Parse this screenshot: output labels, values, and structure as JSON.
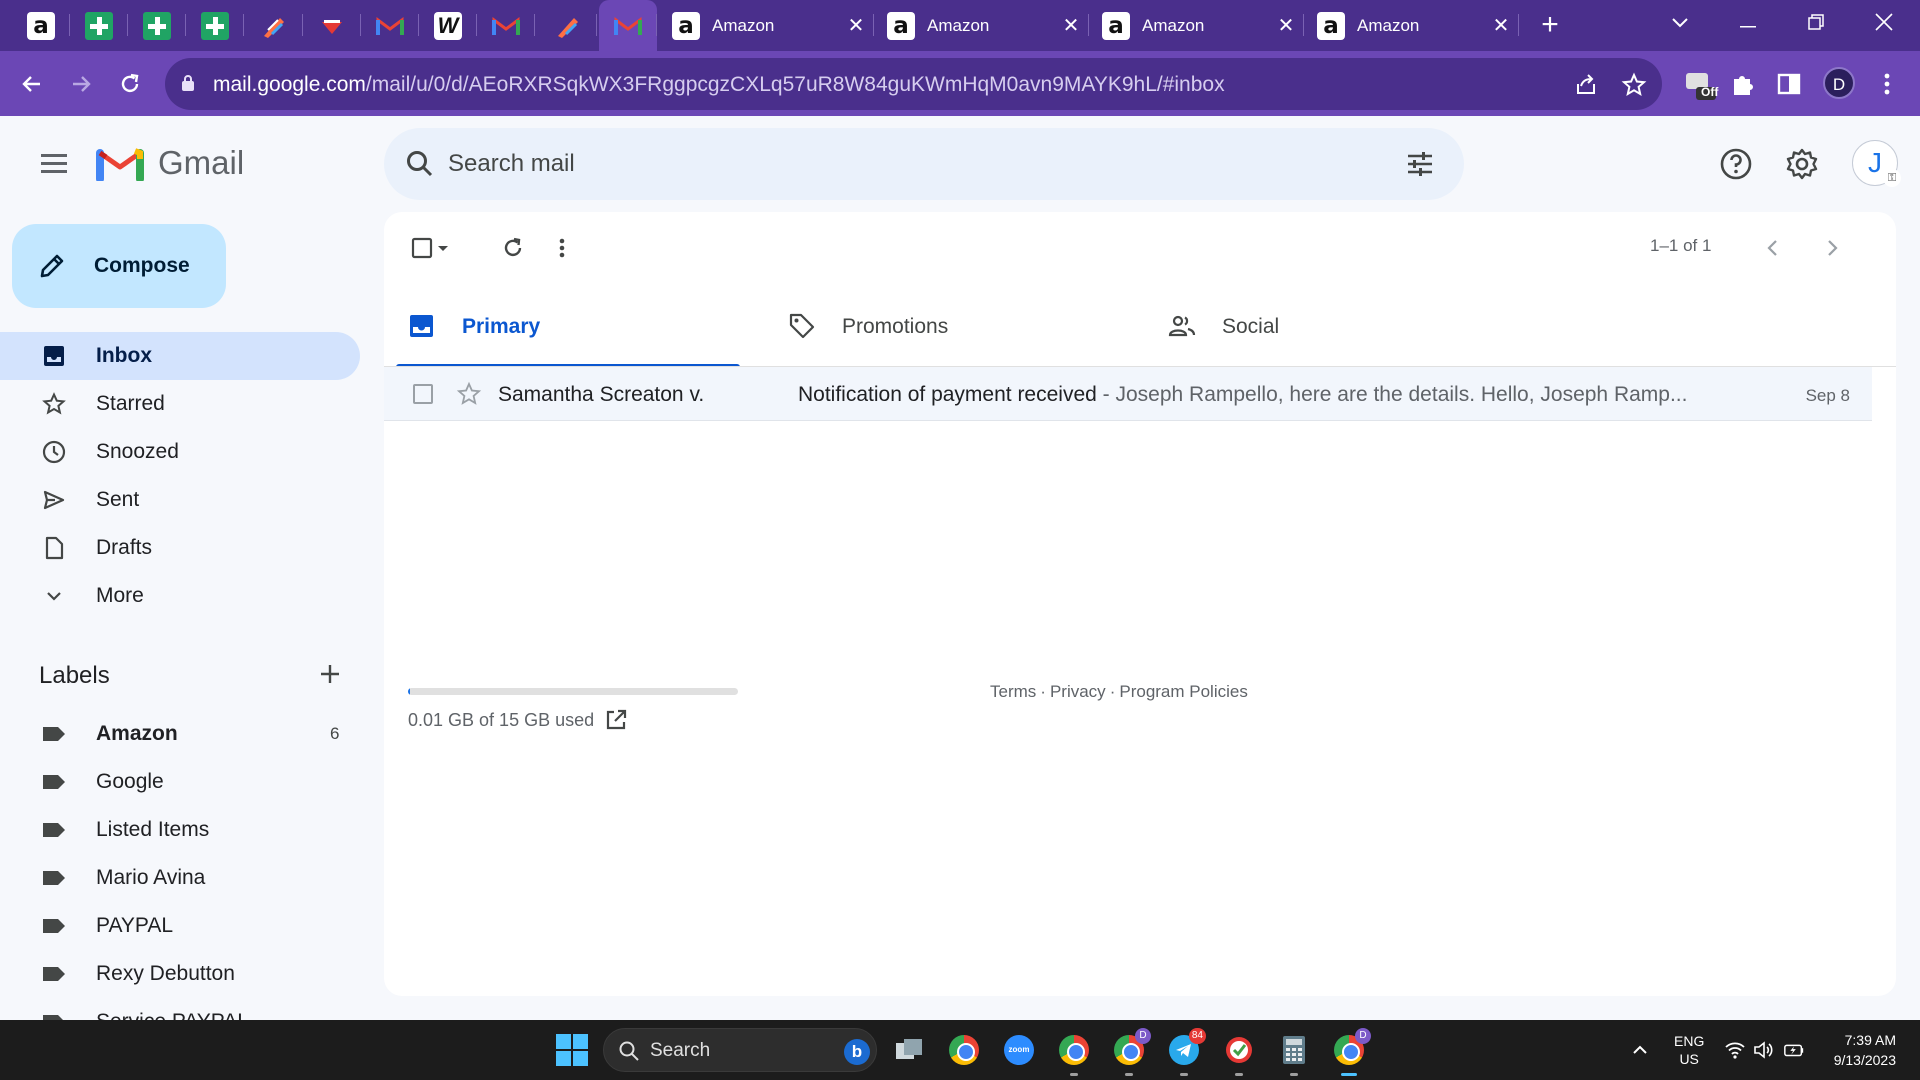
{
  "browser": {
    "pinned_tabs": [
      {
        "icon": "amazon-icon",
        "glyph": "a"
      },
      {
        "icon": "google-sheets-icon"
      },
      {
        "icon": "google-sheets-icon"
      },
      {
        "icon": "google-sheets-icon"
      },
      {
        "icon": "pen-tool-icon"
      },
      {
        "icon": "brand-logo-icon"
      },
      {
        "icon": "gmail-icon"
      },
      {
        "icon": "w-app-icon"
      },
      {
        "icon": "gmail-icon"
      },
      {
        "icon": "pen-tool-icon"
      },
      {
        "icon": "gmail-icon",
        "active": true
      }
    ],
    "tabs": [
      {
        "label": "Amazon",
        "icon_glyph": "a"
      },
      {
        "label": "Amazon",
        "icon_glyph": "a"
      },
      {
        "label": "Amazon",
        "icon_glyph": "a"
      },
      {
        "label": "Amazon",
        "icon_glyph": "a"
      }
    ],
    "url_host": "mail.google.com",
    "url_path": "/mail/u/0/d/AEoRXRSqkWX3FRggpcgzCXLq57uR8W84guKWmHqM0avn9MAYK9hL/#inbox",
    "extension_badge": "Off",
    "profile_initial": "D"
  },
  "gmail": {
    "brand": "Gmail",
    "search_placeholder": "Search mail",
    "account_initial": "J",
    "compose_label": "Compose",
    "nav": [
      {
        "label": "Inbox",
        "icon": "inbox-icon",
        "active": true
      },
      {
        "label": "Starred",
        "icon": "star-icon"
      },
      {
        "label": "Snoozed",
        "icon": "clock-icon"
      },
      {
        "label": "Sent",
        "icon": "send-icon"
      },
      {
        "label": "Drafts",
        "icon": "draft-icon"
      },
      {
        "label": "More",
        "icon": "chevron-down-icon"
      }
    ],
    "labels_heading": "Labels",
    "labels": [
      {
        "name": "Amazon",
        "count": "6",
        "bold": true
      },
      {
        "name": "Google"
      },
      {
        "name": "Listed Items"
      },
      {
        "name": "Mario Avina"
      },
      {
        "name": "PAYPAL"
      },
      {
        "name": "Rexy Debutton"
      },
      {
        "name": "Service PAYPAL"
      }
    ],
    "pagination": "1–1 of 1",
    "tabs": [
      {
        "label": "Primary",
        "icon": "inbox-icon",
        "active": true
      },
      {
        "label": "Promotions",
        "icon": "tag-icon"
      },
      {
        "label": "Social",
        "icon": "people-icon"
      }
    ],
    "emails": [
      {
        "sender": "Samantha Screaton v.",
        "subject": "Notification of payment received",
        "snippet": " - Joseph Rampello, here are the details. Hello, Joseph Ramp...",
        "date": "Sep 8"
      }
    ],
    "storage_text": "0.01 GB of 15 GB used",
    "storage_fraction": 0.001,
    "footer": {
      "terms": "Terms",
      "privacy": "Privacy",
      "policies": "Program Policies",
      "separator": "·"
    }
  },
  "taskbar": {
    "search_label": "Search",
    "lang_line1": "ENG",
    "lang_line2": "US",
    "time": "7:39 AM",
    "date": "9/13/2023",
    "badges": {
      "chrome_profile_1": "D",
      "telegram": "84",
      "chrome_profile_2": "D"
    }
  },
  "colors": {
    "browser_frame": "#4a2f8c",
    "browser_toolbar": "#6b47b5",
    "compose_bg": "#c2e7ff",
    "active_nav": "#d3e3fd",
    "accent_blue": "#0b57d0"
  }
}
